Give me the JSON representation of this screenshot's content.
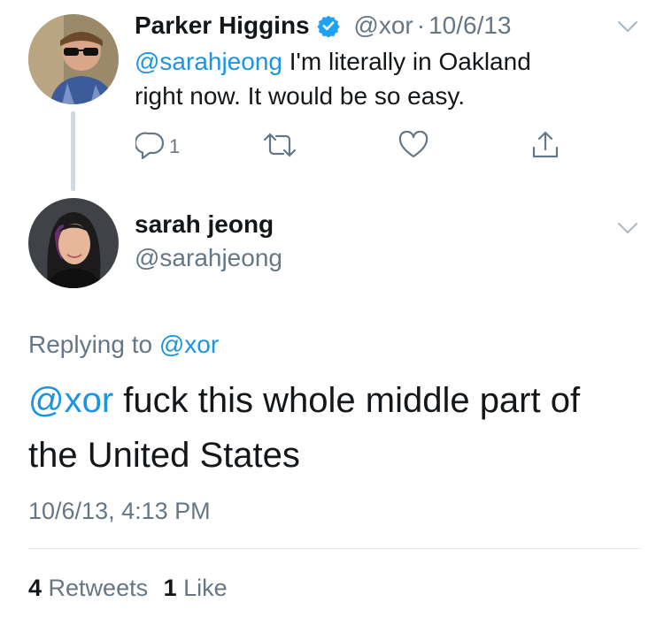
{
  "parent_tweet": {
    "author_name": "Parker Higgins",
    "handle": "@xor",
    "separator": "·",
    "date": "10/6/13",
    "mention": "@sarahjeong",
    "text_line1": " I'm literally in Oakland",
    "text_line2": "right now. It would be so easy.",
    "reply_count": "1"
  },
  "main_tweet": {
    "author_name": "sarah jeong",
    "handle": "@sarahjeong",
    "replying_prefix": "Replying to ",
    "replying_to": "@xor",
    "mention": "@xor",
    "text_line1": " fuck this whole middle part of",
    "text_line2": "the United States",
    "timestamp": "10/6/13, 4:13 PM",
    "retweets_count": "4",
    "retweets_label": " Retweets",
    "likes_count": "1",
    "likes_label": " Like"
  },
  "colors": {
    "link": "#1b95e0",
    "muted": "#657786",
    "verified": "#1da1f2",
    "text": "#14171a"
  },
  "icons": [
    "verified-badge-icon",
    "chevron-down-icon",
    "reply-icon",
    "retweet-icon",
    "like-icon",
    "share-icon"
  ]
}
